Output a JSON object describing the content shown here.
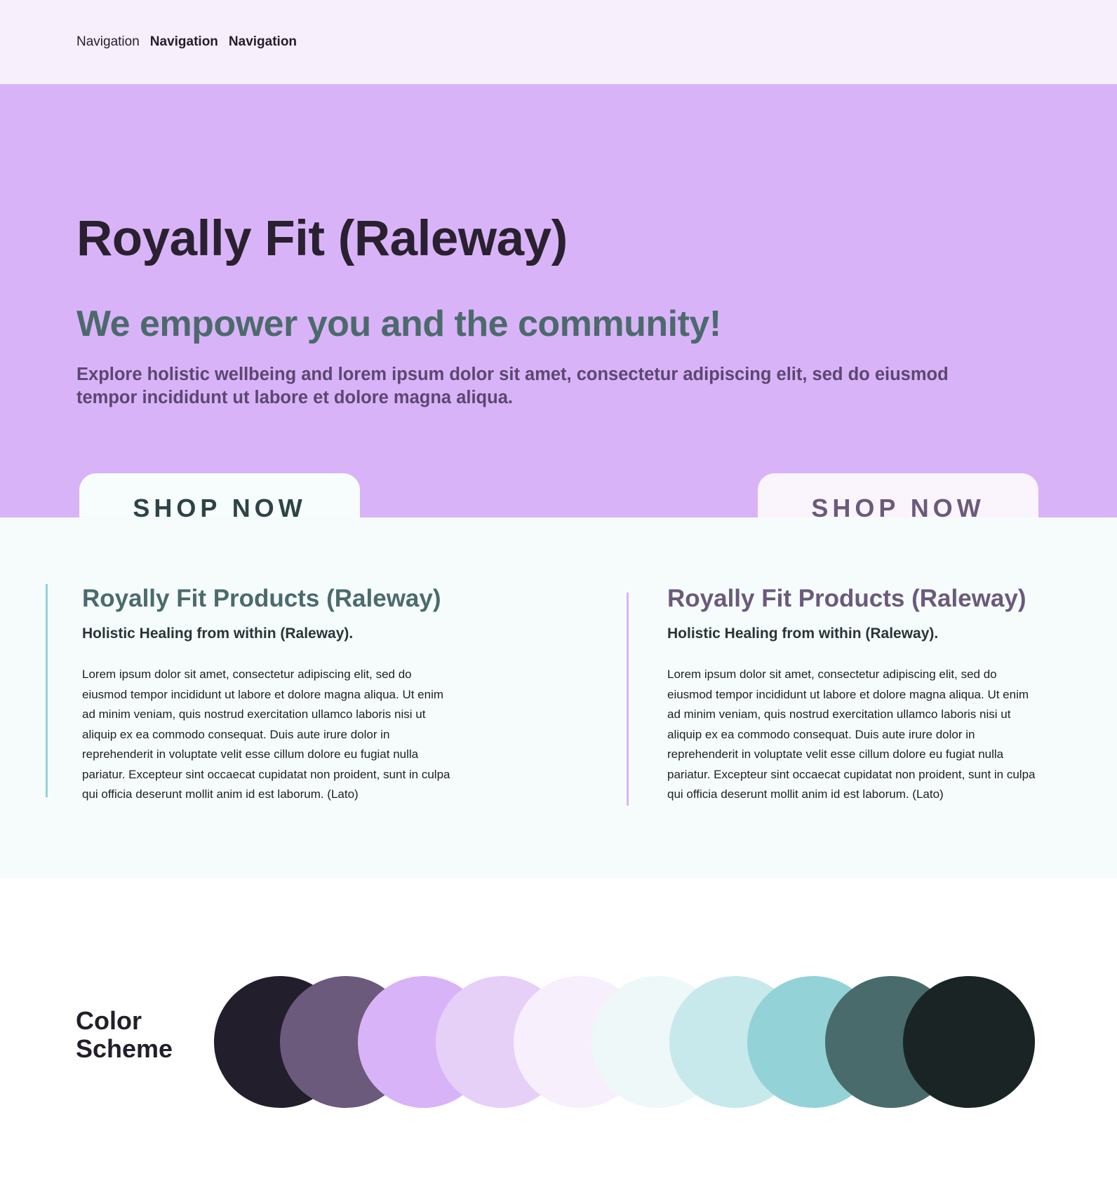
{
  "nav": {
    "items": [
      {
        "label": "Navigation",
        "bold": false
      },
      {
        "label": "Navigation",
        "bold": true
      },
      {
        "label": "Navigation",
        "bold": true
      }
    ]
  },
  "hero": {
    "title": "Royally Fit (Raleway)",
    "subtitle": "We empower you and the community!",
    "description": "Explore holistic wellbeing and lorem ipsum dolor sit amet, consectetur adipiscing elit, sed do eiusmod tempor incididunt ut labore et dolore magna aliqua.",
    "button_left_label": "SHOP NOW",
    "button_right_label": "SHOP NOW"
  },
  "products": [
    {
      "title": "Royally Fit Products (Raleway)",
      "subtitle": "Holistic Healing from within (Raleway).",
      "body": "Lorem ipsum dolor sit amet, consectetur adipiscing elit, sed do eiusmod tempor incididunt ut labore et dolore magna aliqua. Ut enim ad minim veniam, quis nostrud exercitation ullamco laboris nisi ut aliquip ex ea commodo consequat. Duis aute irure dolor in reprehenderit in voluptate velit esse cillum dolore eu fugiat nulla pariatur. Excepteur sint occaecat cupidatat non proident, sunt in culpa qui officia deserunt mollit anim id est laborum. (Lato)"
    },
    {
      "title": "Royally Fit Products (Raleway)",
      "subtitle": "Holistic Healing from within (Raleway).",
      "body": "Lorem ipsum dolor sit amet, consectetur adipiscing elit, sed do eiusmod tempor incididunt ut labore et dolore magna aliqua. Ut enim ad minim veniam, quis nostrud exercitation ullamco laboris nisi ut aliquip ex ea commodo consequat. Duis aute irure dolor in reprehenderit in voluptate velit esse cillum dolore eu fugiat nulla pariatur. Excepteur sint occaecat cupidatat non proident, sunt in culpa qui officia deserunt mollit anim id est laborum. (Lato)"
    }
  ],
  "color_scheme": {
    "title": "Color Scheme",
    "colors": [
      "#231e2b",
      "#6b5a7b",
      "#d9b3f8",
      "#e6d0f7",
      "#f7effc",
      "#eef8f8",
      "#c8e9ec",
      "#93d3d8",
      "#4a6b6b",
      "#1b2424"
    ]
  },
  "colors": {
    "nav_bg": "#f7effc",
    "hero_bg": "#d9b3f8",
    "products_bg": "#f6fcfc",
    "accent_teal": "#93d3d8",
    "accent_purple": "#dab5f3"
  }
}
